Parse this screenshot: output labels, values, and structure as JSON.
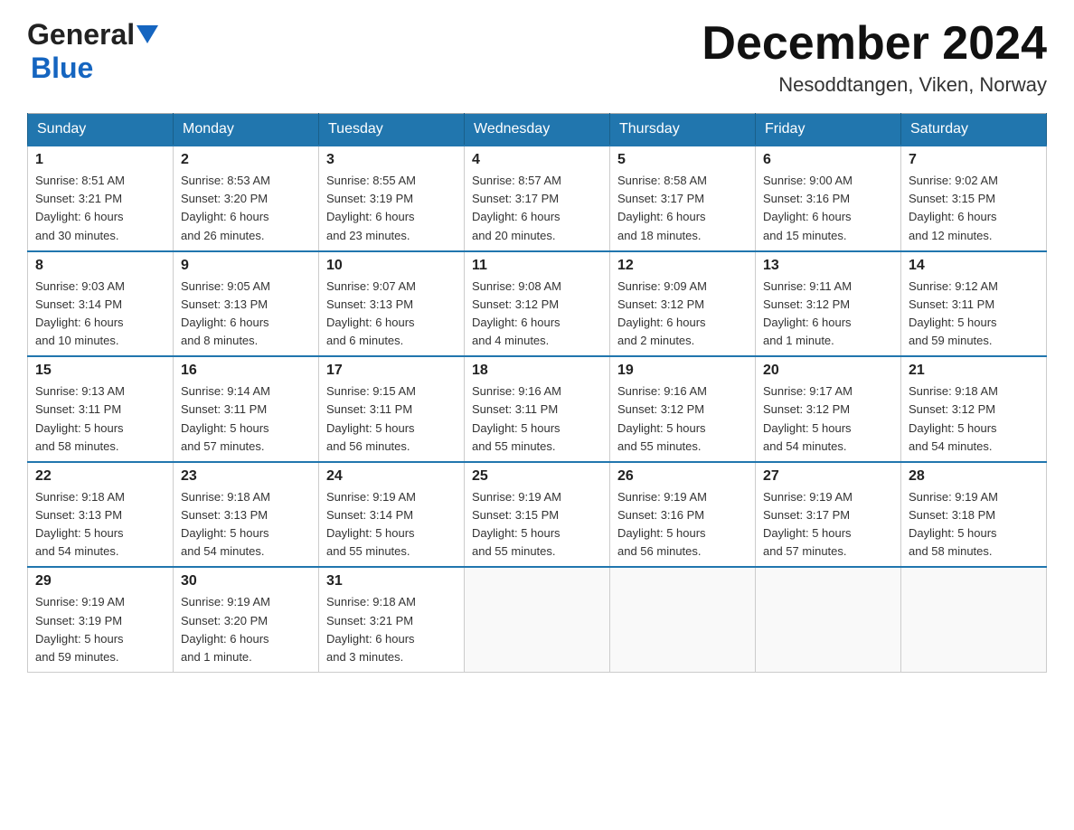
{
  "header": {
    "logo_line1": "General",
    "logo_arrow": "▶",
    "logo_line2": "Blue",
    "title": "December 2024",
    "subtitle": "Nesoddtangen, Viken, Norway"
  },
  "days_of_week": [
    "Sunday",
    "Monday",
    "Tuesday",
    "Wednesday",
    "Thursday",
    "Friday",
    "Saturday"
  ],
  "weeks": [
    [
      {
        "day": "1",
        "info": "Sunrise: 8:51 AM\nSunset: 3:21 PM\nDaylight: 6 hours\nand 30 minutes."
      },
      {
        "day": "2",
        "info": "Sunrise: 8:53 AM\nSunset: 3:20 PM\nDaylight: 6 hours\nand 26 minutes."
      },
      {
        "day": "3",
        "info": "Sunrise: 8:55 AM\nSunset: 3:19 PM\nDaylight: 6 hours\nand 23 minutes."
      },
      {
        "day": "4",
        "info": "Sunrise: 8:57 AM\nSunset: 3:17 PM\nDaylight: 6 hours\nand 20 minutes."
      },
      {
        "day": "5",
        "info": "Sunrise: 8:58 AM\nSunset: 3:17 PM\nDaylight: 6 hours\nand 18 minutes."
      },
      {
        "day": "6",
        "info": "Sunrise: 9:00 AM\nSunset: 3:16 PM\nDaylight: 6 hours\nand 15 minutes."
      },
      {
        "day": "7",
        "info": "Sunrise: 9:02 AM\nSunset: 3:15 PM\nDaylight: 6 hours\nand 12 minutes."
      }
    ],
    [
      {
        "day": "8",
        "info": "Sunrise: 9:03 AM\nSunset: 3:14 PM\nDaylight: 6 hours\nand 10 minutes."
      },
      {
        "day": "9",
        "info": "Sunrise: 9:05 AM\nSunset: 3:13 PM\nDaylight: 6 hours\nand 8 minutes."
      },
      {
        "day": "10",
        "info": "Sunrise: 9:07 AM\nSunset: 3:13 PM\nDaylight: 6 hours\nand 6 minutes."
      },
      {
        "day": "11",
        "info": "Sunrise: 9:08 AM\nSunset: 3:12 PM\nDaylight: 6 hours\nand 4 minutes."
      },
      {
        "day": "12",
        "info": "Sunrise: 9:09 AM\nSunset: 3:12 PM\nDaylight: 6 hours\nand 2 minutes."
      },
      {
        "day": "13",
        "info": "Sunrise: 9:11 AM\nSunset: 3:12 PM\nDaylight: 6 hours\nand 1 minute."
      },
      {
        "day": "14",
        "info": "Sunrise: 9:12 AM\nSunset: 3:11 PM\nDaylight: 5 hours\nand 59 minutes."
      }
    ],
    [
      {
        "day": "15",
        "info": "Sunrise: 9:13 AM\nSunset: 3:11 PM\nDaylight: 5 hours\nand 58 minutes."
      },
      {
        "day": "16",
        "info": "Sunrise: 9:14 AM\nSunset: 3:11 PM\nDaylight: 5 hours\nand 57 minutes."
      },
      {
        "day": "17",
        "info": "Sunrise: 9:15 AM\nSunset: 3:11 PM\nDaylight: 5 hours\nand 56 minutes."
      },
      {
        "day": "18",
        "info": "Sunrise: 9:16 AM\nSunset: 3:11 PM\nDaylight: 5 hours\nand 55 minutes."
      },
      {
        "day": "19",
        "info": "Sunrise: 9:16 AM\nSunset: 3:12 PM\nDaylight: 5 hours\nand 55 minutes."
      },
      {
        "day": "20",
        "info": "Sunrise: 9:17 AM\nSunset: 3:12 PM\nDaylight: 5 hours\nand 54 minutes."
      },
      {
        "day": "21",
        "info": "Sunrise: 9:18 AM\nSunset: 3:12 PM\nDaylight: 5 hours\nand 54 minutes."
      }
    ],
    [
      {
        "day": "22",
        "info": "Sunrise: 9:18 AM\nSunset: 3:13 PM\nDaylight: 5 hours\nand 54 minutes."
      },
      {
        "day": "23",
        "info": "Sunrise: 9:18 AM\nSunset: 3:13 PM\nDaylight: 5 hours\nand 54 minutes."
      },
      {
        "day": "24",
        "info": "Sunrise: 9:19 AM\nSunset: 3:14 PM\nDaylight: 5 hours\nand 55 minutes."
      },
      {
        "day": "25",
        "info": "Sunrise: 9:19 AM\nSunset: 3:15 PM\nDaylight: 5 hours\nand 55 minutes."
      },
      {
        "day": "26",
        "info": "Sunrise: 9:19 AM\nSunset: 3:16 PM\nDaylight: 5 hours\nand 56 minutes."
      },
      {
        "day": "27",
        "info": "Sunrise: 9:19 AM\nSunset: 3:17 PM\nDaylight: 5 hours\nand 57 minutes."
      },
      {
        "day": "28",
        "info": "Sunrise: 9:19 AM\nSunset: 3:18 PM\nDaylight: 5 hours\nand 58 minutes."
      }
    ],
    [
      {
        "day": "29",
        "info": "Sunrise: 9:19 AM\nSunset: 3:19 PM\nDaylight: 5 hours\nand 59 minutes."
      },
      {
        "day": "30",
        "info": "Sunrise: 9:19 AM\nSunset: 3:20 PM\nDaylight: 6 hours\nand 1 minute."
      },
      {
        "day": "31",
        "info": "Sunrise: 9:18 AM\nSunset: 3:21 PM\nDaylight: 6 hours\nand 3 minutes."
      },
      {
        "day": "",
        "info": ""
      },
      {
        "day": "",
        "info": ""
      },
      {
        "day": "",
        "info": ""
      },
      {
        "day": "",
        "info": ""
      }
    ]
  ]
}
